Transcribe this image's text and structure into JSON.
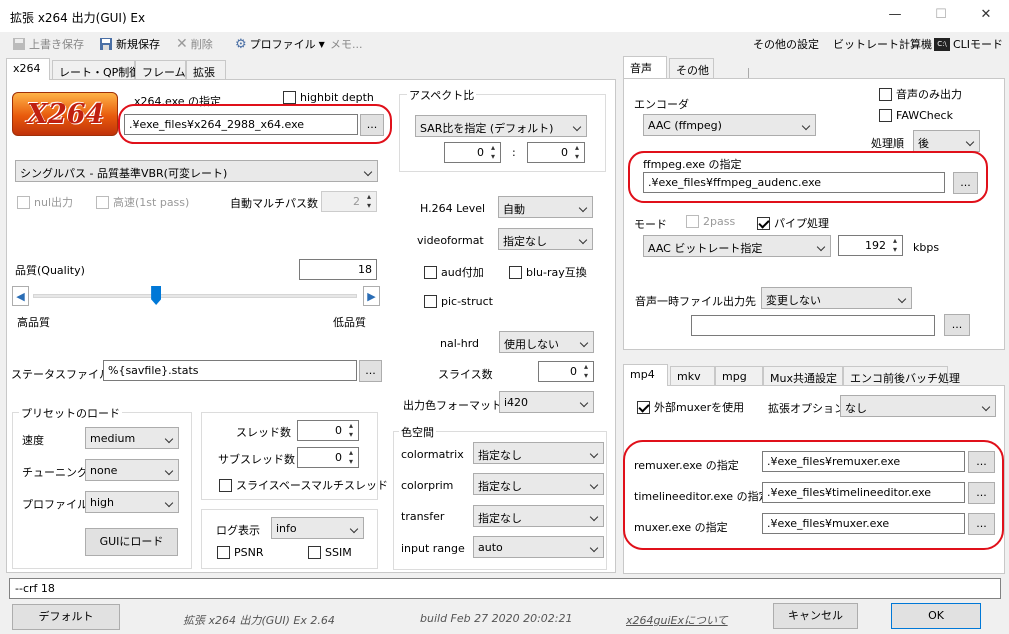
{
  "window": {
    "title": "拡張 x264 出力(GUI) Ex",
    "min": "—",
    "max": "☐",
    "close": "✕"
  },
  "toolbar": {
    "overwrite": "上書き保存",
    "new_save": "新規保存",
    "delete": "削除",
    "profile": "プロファイル",
    "memo": "メモ...",
    "other_settings": "その他の設定",
    "bitrate_calc": "ビットレート計算機",
    "cli_mode": "CLIモード"
  },
  "left_tabs": [
    "x264",
    "レート・QP制御",
    "フレーム",
    "拡張"
  ],
  "x264": {
    "logo_text": "X264",
    "exe_label": "x264.exe の指定",
    "exe_path": ".¥exe_files¥x264_2988_x64.exe",
    "browse": "...",
    "highbit": "highbit depth",
    "mode": "シングルパス - 品質基準VBR(可変レート)",
    "nul": "nul出力",
    "fast": "高速(1st pass)",
    "auto_multipass": "自動マルチパス数",
    "auto_multipass_val": "2",
    "quality_label": "品質(Quality)",
    "quality_val": "18",
    "quality_frac": 0.38,
    "high_quality": "高品質",
    "low_quality": "低品質",
    "stats_label": "ステータスファイル",
    "stats_val": "%{savfile}.stats",
    "preset_group": "プリセットのロード",
    "speed": "速度",
    "speed_val": "medium",
    "tuning": "チューニング",
    "tuning_val": "none",
    "profile": "プロファイル",
    "profile_val": "high",
    "load_gui": "GUIにロード",
    "threads": "スレッド数",
    "threads_val": "0",
    "subthreads": "サブスレッド数",
    "subthreads_val": "0",
    "slice_mt": "スライスベースマルチスレッド",
    "log": "ログ表示",
    "log_val": "info",
    "psnr": "PSNR",
    "ssim": "SSIM",
    "aspect_group": "アスペクト比",
    "aspect_mode": "SAR比を指定 (デフォルト)",
    "aspect_w": "0",
    "aspect_sep": ":",
    "aspect_h": "0",
    "level": "H.264 Level",
    "level_val": "自動",
    "videoformat": "videoformat",
    "videoformat_val": "指定なし",
    "aud": "aud付加",
    "bluray": "blu-ray互換",
    "picstruct": "pic-struct",
    "nalhrd": "nal-hrd",
    "nalhrd_val": "使用しない",
    "slices": "スライス数",
    "slices_val": "0",
    "outcsp": "出力色フォーマット",
    "outcsp_val": "i420",
    "color_group": "色空間",
    "colormatrix": "colormatrix",
    "colormatrix_val": "指定なし",
    "colorprim": "colorprim",
    "colorprim_val": "指定なし",
    "transfer": "transfer",
    "transfer_val": "指定なし",
    "input_range": "input range",
    "input_range_val": "auto"
  },
  "audio_tabs": [
    "音声",
    "その他"
  ],
  "audio": {
    "encoder": "エンコーダ",
    "encoder_val": "AAC (ffmpeg)",
    "audio_only": "音声のみ出力",
    "faw": "FAWCheck",
    "order": "処理順",
    "order_val": "後",
    "exe_label": "ffmpeg.exe の指定",
    "exe_path": ".¥exe_files¥ffmpeg_audenc.exe",
    "mode": "モード",
    "twopass": "2pass",
    "pipe": "パイプ処理",
    "mode_val": "AAC ビットレート指定",
    "bitrate": "192",
    "kbps": "kbps",
    "temp_dir": "音声一時ファイル出力先",
    "temp_val": "変更しない"
  },
  "mux_tabs": [
    "mp4",
    "mkv",
    "mpg",
    "Mux共通設定",
    "エンコ前後バッチ処理"
  ],
  "mux": {
    "external": "外部muxerを使用",
    "ext_opt": "拡張オプション",
    "ext_opt_val": "なし",
    "remuxer_label": "remuxer.exe の指定",
    "remuxer_path": ".¥exe_files¥remuxer.exe",
    "timeline_label": "timelineeditor.exe の指定",
    "timeline_path": ".¥exe_files¥timelineeditor.exe",
    "muxer_label": "muxer.exe の指定",
    "muxer_path": ".¥exe_files¥muxer.exe"
  },
  "cmdline": "--crf 18",
  "footer": {
    "default": "デフォルト",
    "version": "拡張 x264 出力(GUI) Ex 2.64",
    "build": "build Feb 27 2020 20:02:21",
    "about": "x264guiExについて",
    "cancel": "キャンセル",
    "ok": "OK"
  },
  "colors": {
    "highlight": "#e0101a",
    "accent": "#0078d7"
  }
}
